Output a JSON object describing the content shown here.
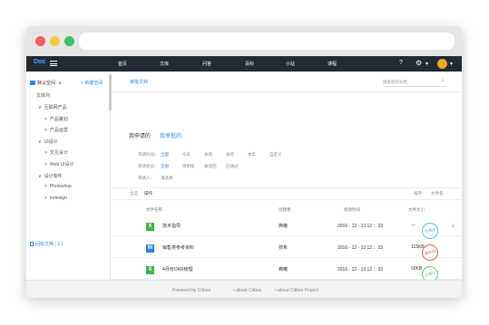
{
  "browser": {
    "colors": {
      "close": "#f25f5c",
      "minimize": "#f7c844",
      "maximize": "#3fc06a"
    }
  },
  "topnav": {
    "logo": "Doc",
    "items": [
      "首页",
      "文库",
      "问答",
      "百科",
      "小站",
      "课程"
    ],
    "help_icon": "?",
    "gear_icon": "⚙",
    "caret": "▾"
  },
  "sidebar": {
    "space": "默认空间",
    "space_caret": "∨",
    "new_space": "+ 新建空间",
    "library": "文库列",
    "tree": [
      {
        "label": "互联网产品",
        "caret": "∨",
        "indent": 1,
        "row": 0
      },
      {
        "label": "产品策划",
        "caret": ">",
        "indent": 2,
        "row": 1
      },
      {
        "label": "产品运营",
        "caret": ">",
        "indent": 2,
        "row": 2
      },
      {
        "label": "UI设计",
        "caret": "∨",
        "indent": 1,
        "row": 3
      },
      {
        "label": "交互设计",
        "caret": ">",
        "indent": 2,
        "row": 4
      },
      {
        "label": "Web UI设计",
        "caret": ">",
        "indent": 2,
        "row": 5
      },
      {
        "label": "设计软件",
        "caret": "∨",
        "indent": 1,
        "row": 6
      },
      {
        "label": "Photoshop",
        "caret": ">",
        "indent": 2,
        "row": 7
      },
      {
        "label": "Indesign",
        "caret": ">",
        "indent": 2,
        "row": 8
      }
    ],
    "recycle": "回收文档 ( 1 )"
  },
  "main": {
    "breadcrumb": "审批文档",
    "search_placeholder": "搜索您的文档",
    "tabs": [
      {
        "label": "我申请的",
        "active": false
      },
      {
        "label": "我审批的",
        "active": true
      }
    ],
    "filters": [
      {
        "label": "审请时间：",
        "options": [
          "全部",
          "今天",
          "本周",
          "本月",
          "本年",
          "自定义"
        ],
        "active": 0
      },
      {
        "label": "审请状态：",
        "options": [
          "全部",
          "待审核",
          "被驳回",
          "已通过"
        ],
        "active": 0
      },
      {
        "label": "审请人：",
        "options": [
          "请选择"
        ],
        "active": -1
      }
    ],
    "toolbar": {
      "all": "全选",
      "action": "操作",
      "sort": "排序：",
      "size_col": "文件名"
    },
    "columns": [
      "文件名称",
      "创建者",
      "修改时间",
      "文件大小"
    ],
    "rows": [
      {
        "icon": "X",
        "icon_color": "#3fb24a",
        "name": "技术指导",
        "creator": "弗曦",
        "time": "2016 - 12 - 13  12 ：33",
        "size": "---",
        "stamp": "已通过",
        "stamp_color": "#5bbcd6"
      },
      {
        "icon": "W",
        "icon_color": "#2e7de0",
        "name": "销售类参考资料",
        "creator": "弥希",
        "time": "2016 - 12 - 13  12 ：33",
        "size": "115KB",
        "stamp": "被驳回",
        "stamp_color": "#e05a5a"
      },
      {
        "icon": "X",
        "icon_color": "#3fb24a",
        "name": "4月份OKR梳理",
        "creator": "弗曦",
        "time": "2016 - 12 - 13  12 ：33",
        "size": "50KB",
        "stamp": "已通过",
        "stamp_color": "#6cc86a"
      }
    ]
  },
  "footer": {
    "powered": "Powered by Citbox",
    "about1": "• about Citbox",
    "about2": "• about Citbox  Project"
  }
}
